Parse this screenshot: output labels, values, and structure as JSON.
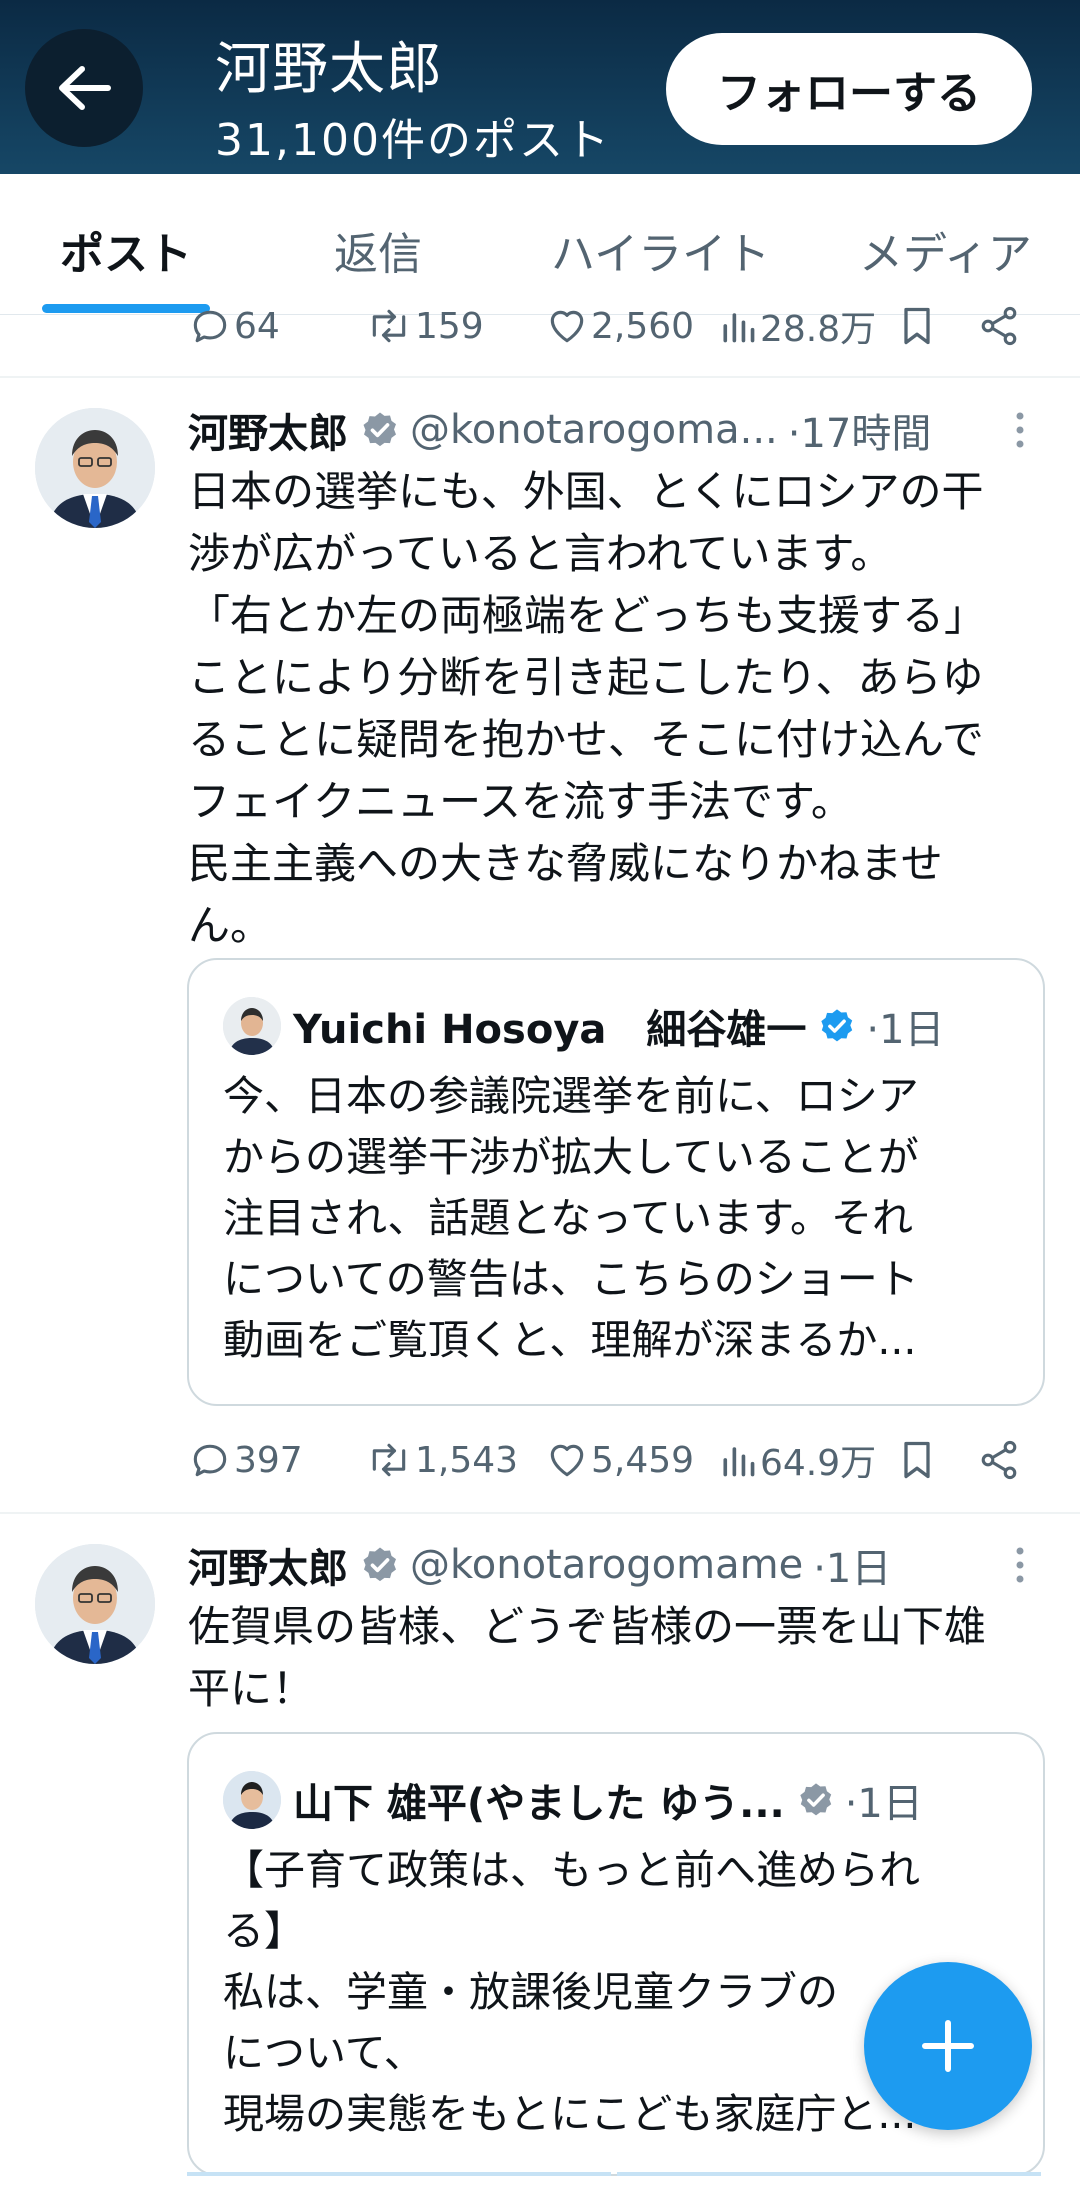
{
  "colors": {
    "accent": "#1d9bf0",
    "header_bg": "#0b2a44",
    "verified": "#1d9bf0",
    "verified_gray": "#8b98a5"
  },
  "header": {
    "back_icon": "arrow-left-icon",
    "name": "河野太郎",
    "post_count": "31,100件のポスト",
    "follow_label": "フォローする"
  },
  "tabs": [
    {
      "label": "ポスト",
      "active": true
    },
    {
      "label": "返信"
    },
    {
      "label": "ハイライト"
    },
    {
      "label": "メディア"
    }
  ],
  "prev_post_actions": {
    "replies": "64",
    "reposts": "159",
    "likes": "2,560",
    "views": "28.8万"
  },
  "posts": [
    {
      "name": "河野太郎",
      "verified": true,
      "handle": "@konotarogoma...",
      "time": "·17時間",
      "text": "日本の選挙にも、外国、とくにロシアの干\n渉が広がっていると言われています。\n「右とか左の両極端をどっちも支援する」\nことにより分断を引き起こしたり、あらゆ\nることに疑問を抱かせ、そこに付け込んで\nフェイクニュースを流す手法です。\n民主主義への大きな脅威になりかねませ\nん。",
      "quote": {
        "name": "Yuichi Hosoya　細谷雄一",
        "verified": true,
        "time": "·1日",
        "text": "今、日本の参議院選挙を前に、ロシア\nからの選挙干渉が拡大していることが\n注目され、話題となっています。それ\nについての警告は、こちらのショート\n動画をご覧頂くと、理解が深まるか..."
      },
      "actions": {
        "replies": "397",
        "reposts": "1,543",
        "likes": "5,459",
        "views": "64.9万"
      }
    },
    {
      "name": "河野太郎",
      "verified": true,
      "handle": "@konotarogomame",
      "time": "·1日",
      "text": "佐賀県の皆様、どうぞ皆様の一票を山下雄\n平に！",
      "quote": {
        "name": "山下 雄平(やました ゆう...",
        "verified": true,
        "time": "·1日",
        "text": "【子育て政策は、もっと前へ進められ\nる】\n私は、学童・放課後児童クラブの\nについて、\n現場の実態をもとにこども家庭庁と..."
      }
    }
  ],
  "fab": {
    "icon": "plus-icon"
  }
}
